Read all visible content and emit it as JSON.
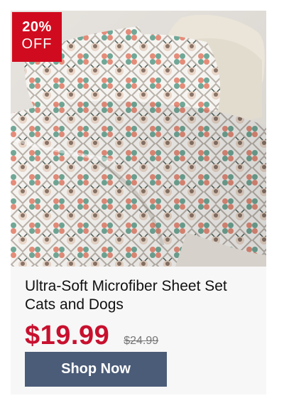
{
  "product": {
    "image_alt": "Bed with cats and dogs print sheet set and pillows",
    "discount": {
      "percent": "20%",
      "label": "OFF"
    },
    "title_line1": "Ultra-Soft Microfiber Sheet Set",
    "title_line2": "Cats and Dogs",
    "sale_price": "$19.99",
    "original_price": "$24.99",
    "cta_label": "Shop Now"
  },
  "colors": {
    "badge": "#d10b1f",
    "sale_price": "#c8102e",
    "button": "#4b5c78",
    "card_background": "#f7f7f7"
  }
}
